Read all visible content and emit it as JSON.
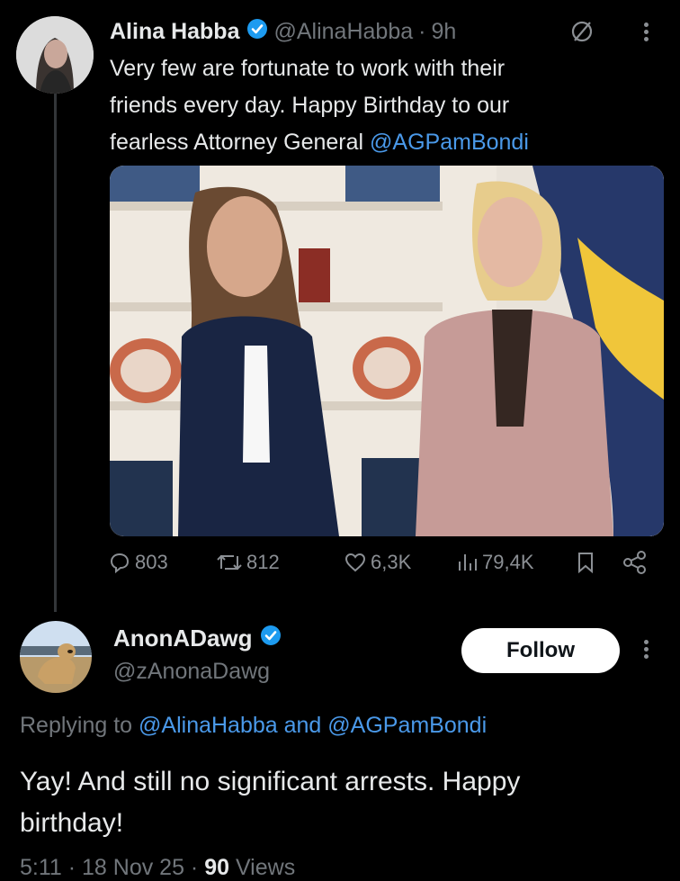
{
  "tweet": {
    "display_name": "Alina Habba",
    "handle": "@AlinaHabba",
    "separator": "·",
    "time": "9h",
    "text_line1": "Very few are fortunate to work with their",
    "text_line2": "friends every day. Happy Birthday to our",
    "text_line3_prefix": "fearless Attorney General ",
    "text_mention": "@AGPamBondi",
    "actions": {
      "replies": "803",
      "reposts": "812",
      "likes": "6,3K",
      "views": "79,4K"
    }
  },
  "reply": {
    "display_name": "AnonADawg",
    "handle": "@zAnonaDawg",
    "follow_label": "Follow",
    "replying_prefix": "Replying to ",
    "replying_mention1": "@AlinaHabba",
    "replying_and": " and ",
    "replying_mention2": "@AGPamBondi",
    "text_line1": "Yay! And still no significant arrests. Happy",
    "text_line2": "birthday!",
    "meta_time": "5:11 · 18 Nov 25 · ",
    "meta_views_count": "90",
    "meta_views_label": " Views"
  },
  "colors": {
    "background": "#000000",
    "text": "#e7e9ea",
    "muted": "#71767b",
    "link": "#4a99e9",
    "verified": "#1d9bf0"
  },
  "icons": [
    "verified-badge-icon",
    "grok-slash-icon",
    "more-icon",
    "reply-icon",
    "repost-icon",
    "like-icon",
    "views-icon",
    "bookmark-icon",
    "share-icon"
  ]
}
